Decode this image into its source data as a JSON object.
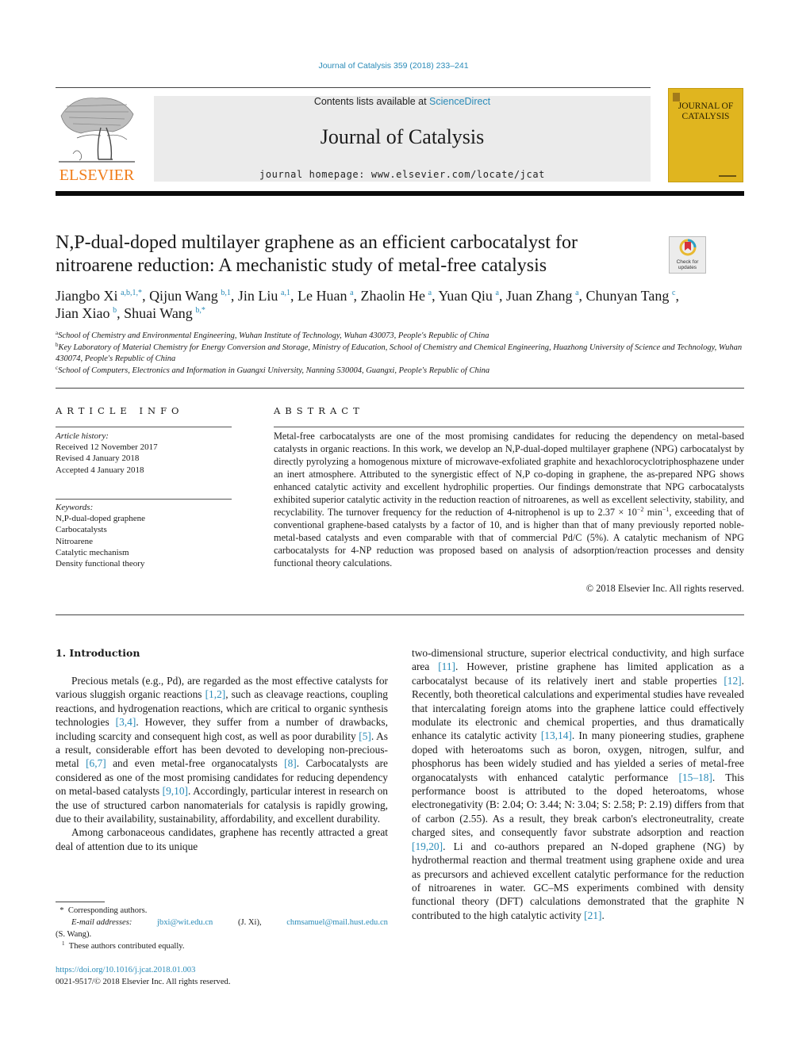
{
  "header": {
    "journal_reference": "Journal of Catalysis 359 (2018) 233–241",
    "publisher_logo_text": "ELSEVIER",
    "contents_prefix": "Contents lists available at ",
    "contents_link": "ScienceDirect",
    "journal_name": "Journal of Catalysis",
    "homepage_line": "journal homepage: www.elsevier.com/locate/jcat",
    "cover_title_line1": "JOURNAL OF",
    "cover_title_line2": "CATALYSIS",
    "colors": {
      "link": "#2a8bb8",
      "elsevier_orange": "#f07d1a",
      "cover_yellow": "#e0b51f",
      "masthead_gray": "#ebebeb"
    }
  },
  "article": {
    "title": "N,P-dual-doped multilayer graphene as an efficient carbocatalyst for nitroarene reduction: A mechanistic study of metal-free catalysis",
    "check_updates_line1": "Check for",
    "check_updates_line2": "updates",
    "authors": [
      {
        "name": "Jiangbo Xi",
        "sup": "a,b,1,*",
        "sep": ", "
      },
      {
        "name": "Qijun Wang",
        "sup": "b,1",
        "sep": ", "
      },
      {
        "name": "Jin Liu",
        "sup": "a,1",
        "sep": ", "
      },
      {
        "name": "Le Huan",
        "sup": "a",
        "sep": ", "
      },
      {
        "name": "Zhaolin He",
        "sup": "a",
        "sep": ", "
      },
      {
        "name": "Yuan Qiu",
        "sup": "a",
        "sep": ", "
      },
      {
        "name": "Juan Zhang",
        "sup": "a",
        "sep": ", "
      },
      {
        "name": "Chunyan Tang",
        "sup": "c",
        "sep": ","
      },
      {
        "name": "Jian Xiao",
        "sup": "b",
        "sep": ", "
      },
      {
        "name": "Shuai Wang",
        "sup": "b,*",
        "sep": ""
      }
    ],
    "affiliations": [
      {
        "mark": "a",
        "text": "School of Chemistry and Environmental Engineering, Wuhan Institute of Technology, Wuhan 430073, People's Republic of China"
      },
      {
        "mark": "b",
        "text": "Key Laboratory of Material Chemistry for Energy Conversion and Storage, Ministry of Education, School of Chemistry and Chemical Engineering, Huazhong University of Science and Technology, Wuhan 430074, People's Republic of China"
      },
      {
        "mark": "c",
        "text": "School of Computers, Electronics and Information in Guangxi University, Nanning 530004, Guangxi, People's Republic of China"
      }
    ]
  },
  "article_info": {
    "heading": "ARTICLE INFO",
    "history_label": "Article history:",
    "history": [
      "Received 12 November 2017",
      "Revised 4 January 2018",
      "Accepted 4 January 2018"
    ],
    "keywords_label": "Keywords:",
    "keywords": [
      "N,P-dual-doped graphene",
      "Carbocatalysts",
      "Nitroarene",
      "Catalytic mechanism",
      "Density functional theory"
    ]
  },
  "abstract": {
    "heading": "ABSTRACT",
    "text_part1": "Metal-free carbocatalysts are one of the most promising candidates for reducing the dependency on metal-based catalysts in organic reactions. In this work, we develop an N,P-dual-doped multilayer graphene (NPG) carbocatalyst by directly pyrolyzing a homogenous mixture of microwave-exfoliated graphite and hexachlorocyclotriphosphazene under an inert atmosphere. Attributed to the synergistic effect of N,P co-doping in graphene, the as-prepared NPG shows enhanced catalytic activity and excellent hydrophilic properties. Our findings demonstrate that NPG carbocatalysts exhibited superior catalytic activity in the reduction reaction of nitroarenes, as well as excellent selectivity, stability, and recyclability. The turnover frequency for the reduction of 4-nitrophenol is up to 2.37 × 10",
    "exp1": "−2",
    "text_part2": " min",
    "exp2": "−1",
    "text_part3": ", exceeding that of conventional graphene-based catalysts by a factor of 10, and is higher than that of many previously reported noble-metal-based catalysts and even comparable with that of commercial Pd/C (5%). A catalytic mechanism of NPG carbocatalysts for 4-NP reduction was proposed based on analysis of adsorption/reaction processes and density functional theory calculations.",
    "copyright": "© 2018 Elsevier Inc. All rights reserved."
  },
  "introduction": {
    "heading": "1. Introduction",
    "left_paragraphs": [
      {
        "indent": true,
        "segments": [
          {
            "t": "Precious metals (e.g., Pd), are regarded as the most effective catalysts for various sluggish organic reactions "
          },
          {
            "t": "[1,2]",
            "cite": true
          },
          {
            "t": ", such as cleavage reactions, coupling reactions, and hydrogenation reactions, which are critical to organic synthesis technologies "
          },
          {
            "t": "[3,4]",
            "cite": true
          },
          {
            "t": ". However, they suffer from a number of drawbacks, including scarcity and consequent high cost, as well as poor durability "
          },
          {
            "t": "[5]",
            "cite": true
          },
          {
            "t": ". As a result, considerable effort has been devoted to developing non-precious-metal "
          },
          {
            "t": "[6,7]",
            "cite": true
          },
          {
            "t": " and even metal-free organocatalysts "
          },
          {
            "t": "[8]",
            "cite": true
          },
          {
            "t": ". Carbocatalysts are considered as one of the most promising candidates for reducing dependency on metal-based catalysts "
          },
          {
            "t": "[9,10]",
            "cite": true
          },
          {
            "t": ". Accordingly, particular interest in research on the use of structured carbon nanomaterials for catalysis is rapidly growing, due to their availability, sustainability, affordability, and excellent durability."
          }
        ]
      },
      {
        "indent": true,
        "segments": [
          {
            "t": "Among carbonaceous candidates, graphene has recently attracted a great deal of attention due to its unique"
          }
        ]
      }
    ],
    "right_paragraphs": [
      {
        "indent": false,
        "segments": [
          {
            "t": "two-dimensional structure, superior electrical conductivity, and high surface area "
          },
          {
            "t": "[11]",
            "cite": true
          },
          {
            "t": ". However, pristine graphene has limited application as a carbocatalyst because of its relatively inert and stable properties "
          },
          {
            "t": "[12]",
            "cite": true
          },
          {
            "t": ". Recently, both theoretical calculations and experimental studies have revealed that intercalating foreign atoms into the graphene lattice could effectively modulate its electronic and chemical properties, and thus dramatically enhance its catalytic activity "
          },
          {
            "t": "[13,14]",
            "cite": true
          },
          {
            "t": ". In many pioneering studies, graphene doped with heteroatoms such as boron, oxygen, nitrogen, sulfur, and phosphorus has been widely studied and has yielded a series of metal-free organocatalysts with enhanced catalytic performance "
          },
          {
            "t": "[15–18]",
            "cite": true
          },
          {
            "t": ". This performance boost is attributed to the doped heteroatoms, whose electronegativity (B: 2.04; O: 3.44; N: 3.04; S: 2.58; P: 2.19) differs from that of carbon (2.55). As a result, they break carbon's electroneutrality, create charged sites, and consequently favor substrate adsorption and reaction "
          },
          {
            "t": "[19,20]",
            "cite": true
          },
          {
            "t": ". Li and co-authors prepared an N-doped graphene (NG) by hydrothermal reaction and thermal treatment using graphene oxide and urea as precursors and achieved excellent catalytic performance for the reduction of nitroarenes in water. GC–MS experiments combined with density functional theory (DFT) calculations demonstrated that the graphite N contributed to the high catalytic activity "
          },
          {
            "t": "[21]",
            "cite": true
          },
          {
            "t": "."
          }
        ]
      }
    ]
  },
  "footnotes": {
    "corresponding_mark": "*",
    "corresponding_text": "Corresponding authors.",
    "email_label": "E-mail addresses:",
    "email1": "jbxi@wit.edu.cn",
    "email1_owner": "(J. Xi),",
    "email2": "chmsamuel@mail.hust.edu.cn",
    "email2_owner": "(S. Wang).",
    "equal_mark": "1",
    "equal_text": "These authors contributed equally."
  },
  "doi": {
    "link": "https://doi.org/10.1016/j.jcat.2018.01.003",
    "issn_line": "0021-9517/© 2018 Elsevier Inc. All rights reserved."
  }
}
